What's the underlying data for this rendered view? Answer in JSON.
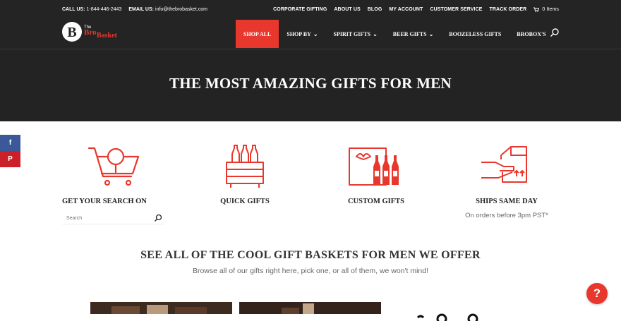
{
  "topbar": {
    "call_label": "CALL US:",
    "call_number": "1-844-446-2443",
    "email_label": "EMAIL US:",
    "email": "info@thebrobasket.com",
    "links": [
      "CORPORATE GIFTING",
      "ABOUT US",
      "BLOG",
      "MY ACCOUNT",
      "CUSTOMER SERVICE",
      "TRACK ORDER"
    ],
    "cart_count": "0 Items"
  },
  "logo": {
    "letter": "B",
    "text_top": "The",
    "text_main": "Bro",
    "text_main2": "Basket"
  },
  "nav": {
    "items": [
      {
        "label": "SHOP ALL"
      },
      {
        "label": "SHOP BY",
        "chevron": "⌄"
      },
      {
        "label": "SPIRIT GIFTS",
        "chevron": "⌄"
      },
      {
        "label": "BEER GIFTS",
        "chevron": "⌄"
      },
      {
        "label": "BOOZELESS GIFTS"
      },
      {
        "label": "BROBOX'S"
      }
    ]
  },
  "hero": {
    "title": "THE MOST AMAZING GIFTS FOR MEN"
  },
  "social": {
    "facebook": "f",
    "pinterest": "P"
  },
  "features": [
    {
      "title": "GET YOUR SEARCH ON",
      "icon": "cart-search-icon"
    },
    {
      "title": "QUICK GIFTS",
      "icon": "bottle-crate-icon"
    },
    {
      "title": "CUSTOM GIFTS",
      "icon": "gift-box-bottles-icon"
    },
    {
      "title": "SHIPS SAME DAY",
      "subtitle": "On orders before 3pm PST*",
      "icon": "delivery-box-icon"
    }
  ],
  "search": {
    "placeholder": "Search"
  },
  "section": {
    "title": "SEE ALL OF THE COOL GIFT BASKETS FOR MEN WE OFFER",
    "subtitle": "Browse all of our gifts right here, pick one, or all of them, we won't mind!"
  },
  "help": {
    "symbol": "?"
  },
  "colors": {
    "accent": "#e8382d",
    "header_bg": "#242424"
  }
}
